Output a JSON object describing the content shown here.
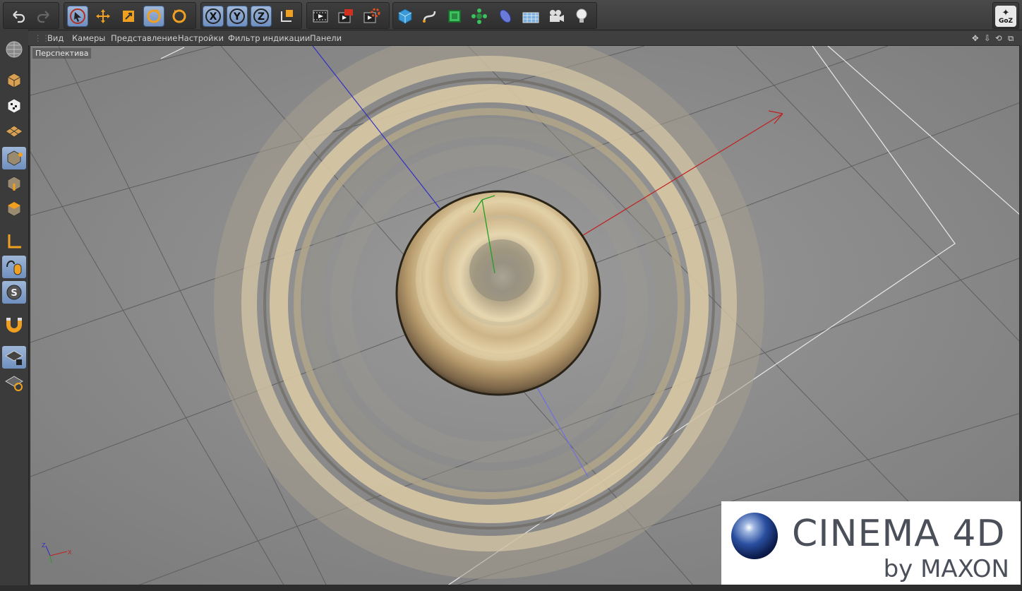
{
  "toolbar": {
    "undo": "undo-icon",
    "redo": "redo-icon",
    "tools": [
      "select-icon",
      "move-icon",
      "scale-icon",
      "rotate-icon",
      "rotate-last-icon"
    ],
    "axes": [
      "X",
      "Y",
      "Z"
    ],
    "coord_system": "world-coordinates-icon",
    "render": [
      "render-view-icon",
      "render-picture-viewer-icon",
      "render-settings-icon"
    ],
    "objects": [
      "cube-icon",
      "spline-pen-icon",
      "subdivision-icon",
      "array-icon",
      "deformer-icon",
      "floor-icon",
      "camera-icon",
      "light-icon"
    ],
    "goz_label": "GoZ"
  },
  "left_palette": [
    "make-editable-icon",
    "texture-mode-icon",
    "workplane-icon",
    "points-mode-icon",
    "edges-mode-icon",
    "polygons-mode-icon",
    "axis-mode-icon",
    "tweak-mode-icon",
    "snap-icon",
    "magnet-icon",
    "lock-workplane-icon",
    "modelling-axis-icon"
  ],
  "view_menu": {
    "items": [
      "Вид",
      "Камеры",
      "Представление",
      "Настройки",
      "Фильтр индикации",
      "Панели"
    ]
  },
  "viewport": {
    "label": "Перспектива",
    "axis_labels": {
      "x": "X",
      "y": "Y",
      "z": "Z"
    }
  },
  "logo": {
    "title": "CINEMA 4D",
    "subtitle": "by MAXON"
  },
  "colors": {
    "active_blue": "#8aa6d0",
    "viewport_bg": "#8a8a8a",
    "x_axis": "#c02020",
    "y_axis": "#20a020",
    "z_axis": "#3030c0"
  }
}
